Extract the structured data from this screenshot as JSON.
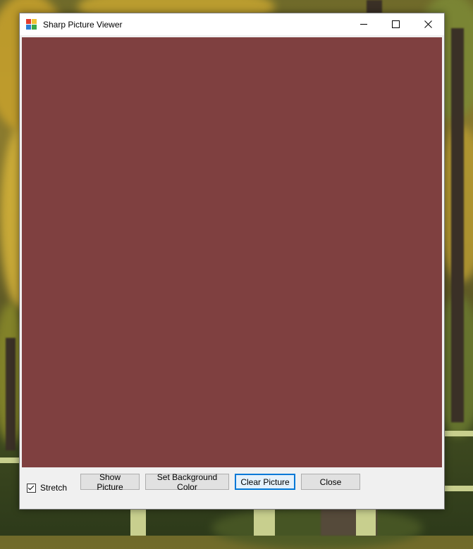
{
  "window": {
    "title": "Sharp Picture Viewer",
    "controls": {
      "minimize_icon": "minimize-icon",
      "maximize_icon": "maximize-icon",
      "close_icon": "close-icon"
    }
  },
  "picture": {
    "background_color": "#7f4040"
  },
  "options": {
    "stretch_label": "Stretch",
    "stretch_checked": true
  },
  "buttons": {
    "show_picture": "Show Picture",
    "set_background_color": "Set Background Color",
    "clear_picture": "Clear Picture",
    "close": "Close"
  },
  "colors": {
    "focus_border": "#0078d7",
    "button_face": "#e1e1e1",
    "window_face": "#f0f0f0"
  }
}
